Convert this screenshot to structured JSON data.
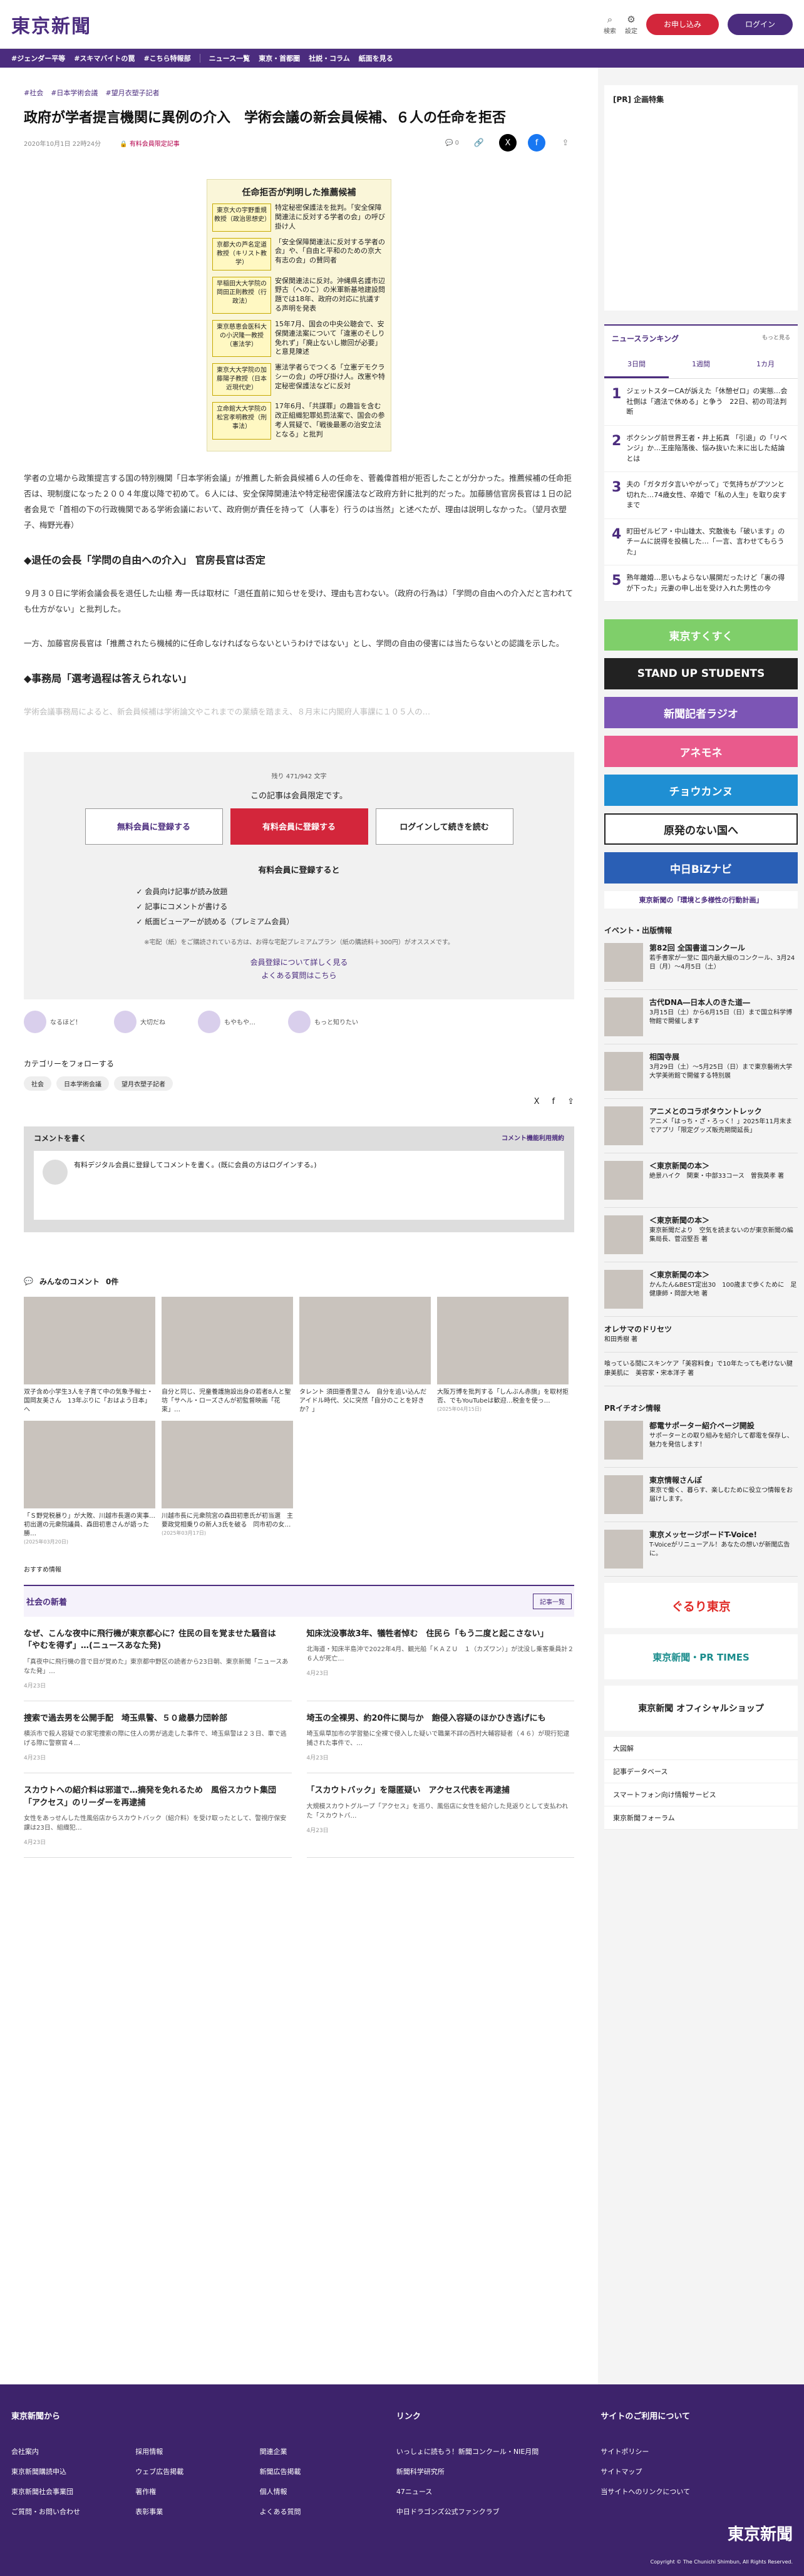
{
  "header": {
    "logo": "東京新聞",
    "search_label": "検索",
    "settings_label": "設定",
    "subscribe": "お申し込み",
    "login": "ログイン"
  },
  "nav": {
    "items": [
      "#ジェンダー平等",
      "#スキマバイトの罠",
      "#こちら特報部",
      "ニュース一覧",
      "東京・首都圏",
      "社説・コラム",
      "紙面を見る"
    ]
  },
  "article": {
    "tags": [
      "#社会",
      "#日本学術会議",
      "#望月衣塑子記者"
    ],
    "title": "政府が学者提言機関に異例の介入　学術会議の新会員候補、６人の任命を拒否",
    "date": "2020年10月1日 22時24分",
    "member_badge": "有料会員限定記事",
    "comment_count": "0",
    "figure_title": "任命拒否が判明した推薦候補",
    "figure_rows": [
      {
        "name": "東京大の宇野重規教授（政治思想史）",
        "desc": "特定秘密保護法を批判。「安全保障関連法に反対する学者の会」の呼び掛け人"
      },
      {
        "name": "京都大の芦名定道教授（キリスト教学）",
        "desc": "「安全保障関連法に反対する学者の会」や、「自由と平和のための京大有志の会」の賛同者"
      },
      {
        "name": "早稲田大大学院の岡田正則教授（行政法）",
        "desc": "安保関連法に反対。沖縄県名護市辺野古（へのこ）の米軍新基地建設問題では18年、政府の対応に抗議する声明を発表"
      },
      {
        "name": "東京慈恵会医科大の小沢隆一教授（憲法学）",
        "desc": "15年7月、国会の中央公聴会で、安保関連法案について「違憲のそしり免れず」「廃止ないし撤回が必要」と意見陳述"
      },
      {
        "name": "東京大大学院の加藤陽子教授（日本近現代史）",
        "desc": "憲法学者らでつくる「立憲デモクラシーの会」の呼び掛け人。改憲や特定秘密保護法などに反対"
      },
      {
        "name": "立命館大大学院の松宮孝明教授（刑事法）",
        "desc": "17年6月、「共謀罪」の趣旨を含む改正組織犯罪処罰法案で、国会の参考人質疑で、「戦後最悪の治安立法となる」と批判"
      }
    ],
    "p1": "学者の立場から政策提言する国の特別機関「日本学術会議」が推薦した新会員候補６人の任命を、菅義偉首相が拒否したことが分かった。推薦候補の任命拒否は、現制度になった２００４年度以降で初めて。６人には、安全保障関連法や特定秘密保護法など政府方針に批判的だった。加藤勝信官房長官は１日の記者会見で「首相の下の行政機関である学術会議において、政府側が責任を持って（人事を）行うのは当然」と述べたが、理由は説明しなかった。（望月衣塑子、梅野光春）",
    "h2a": "◆退任の会長「学問の自由への介入」 官房長官は否定",
    "p2": "９月３０日に学術会議会長を退任した山極 寿一氏は取材に「退任直前に知らせを受け、理由も言わない。（政府の行為は）「学問の自由への介入だと言われても仕方がない」と批判した。",
    "p3": "一方、加藤官房長官は「推薦されたら機械的に任命しなければならないというわけではない」とし、学問の自由の侵害には当たらないとの認識を示した。",
    "h2b": "◆事務局「選考過程は答えられない」",
    "p4": "学術会議事務局によると、新会員候補は学術論文やこれまでの業績を踏まえ、８月末に内閣府人事課に１０５人の…"
  },
  "paywall": {
    "count": "残り 471/942 文字",
    "lead": "この記事は会員限定です。",
    "free_btn": "無料会員に登録する",
    "paid_btn": "有料会員に登録する",
    "login_btn": "ログインして続きを読む",
    "sub": "有料会員に登録すると",
    "benefits": [
      "会員向け記事が読み放題",
      "記事にコメントが書ける",
      "紙面ビューアーが読める（プレミアム会員）"
    ],
    "note": "※宅配（紙）をご購読されている方は、お得な宅配プレミアムプラン（紙の購読料＋300円）がオススメです。",
    "link1": "会員登録について詳しく見る",
    "link2": "よくある質問はこちら"
  },
  "reactions": [
    "なるほど！",
    "大切だね",
    "もやもや…",
    "もっと知りたい"
  ],
  "follow": {
    "title": "カテゴリーをフォローする",
    "chips": [
      "社会",
      "日本学術会議",
      "望月衣塑子記者"
    ]
  },
  "comment": {
    "title": "コメントを書く",
    "policy": "コメント機能利用規約",
    "prompt": "有料デジタル会員に登録してコメントを書く。(既に会員の方はログインする。)"
  },
  "everyone": {
    "title": "みんなのコメント",
    "count": "0件"
  },
  "pics": [
    {
      "t": "双子含め小学生3人を子育て中の気象予報士・国岡友美さん　13年ぶりに「おはよう日本」へ",
      "d": ""
    },
    {
      "t": "自分と同じ、児童養護施設出身の若者8人と聖坊「サヘル・ローズさんが初監督映画「花束」…",
      "d": ""
    },
    {
      "t": "タレント 須田亜香里さん　自分を追い込んだアイドル時代、父に突然「自分のことを好きか？」",
      "d": ""
    },
    {
      "t": "大阪万博を批判する「しんぶん赤旗」を取材拒否、でもYouTubeは歓迎…税金を使っ…",
      "d": "(2025年04月15日)"
    },
    {
      "t": "「Ｓ野党税暴り」が大敗、川越市長選の実事…初出選の元衆院議員、森田初恵さんが語った勝…",
      "d": "(2025年03月20日)"
    },
    {
      "t": "川越市長に元衆院宮の森田初恵氏が初当選　主要政党相乗りの新人3氏を破る　同市初の女…",
      "d": "(2025年03月17日)"
    }
  ],
  "recommend": "おすすめ情報",
  "news": {
    "title": "社会の新着",
    "more": "記事一覧",
    "items": [
      {
        "ttl": "なぜ、こんな夜中に飛行機が東京都心に？住民の目を覚ませた騒音は「やむを得ず」…(ニュースあなた発)",
        "ex": "「真夜中に飛行機の音で目が覚めた」東京都中野区の読者から23日朝、東京新聞「ニュースあなた発」…",
        "dt": "4月23日"
      },
      {
        "ttl": "知床沈没事故3年、犠牲者悼む　住民ら「もう二度と起こさない」",
        "ex": "北海道・知床半島沖で2022年4月、観光船「ＫＡＺＵ　１（カズワン）」が沈没し乗客乗員計２６人が死亡…",
        "dt": "4月23日"
      },
      {
        "ttl": "捜索で過去男を公開手配　埼玉県警、５０歳暴力団幹部",
        "ex": "横浜市で殺人容疑での家宅捜索の際に住人の男が逃走した事件で、埼玉県警は２３日、車で逃げる際に警察官４…",
        "dt": "4月23日"
      },
      {
        "ttl": "埼玉の全裸男、約20件に関与か　飽侵入容疑のほかひき逃げにも",
        "ex": "埼玉県草加市の学習塾に全裸で侵入した疑いで職業不詳の西村大輔容疑者（４６）が現行犯逮捕された事件で、…",
        "dt": "4月23日"
      },
      {
        "ttl": "スカウトへの紹介料は邪道で…摘発を免れるため　風俗スカウト集団「アクセス」のリーダーを再逮捕",
        "ex": "女性をあっせんした性風俗店からスカウトバック（紹介料）を受け取ったとして、警視庁保安課は23日、組織犯…",
        "dt": "4月23日"
      },
      {
        "ttl": "「スカウトバック」を隠匿疑い　アクセス代表を再逮捕",
        "ex": "大規模スカウトグループ「アクセス」を巡り、風俗店に女性を紹介した見返りとして支払われた「スカウトバ…",
        "dt": "4月23日"
      }
    ]
  },
  "side": {
    "pr_title": "[PR] 企画特集",
    "rank_title": "ニュースランキング",
    "rank_more": "もっと見る",
    "rank_tabs": [
      "3日間",
      "1週間",
      "1カ月"
    ],
    "rank": [
      "ジェットスターCAが訴えた「休憩ゼロ」の実態…会社側は「適法で休める」と争う　22日、初の司法判断",
      "ボクシング前世界王者・井上拓真 「引退」の「リベンジ」か…王座陥落後、悩み抜いた末に出した結論とは",
      "夫の「ガタガタ言いやがって」で気持ちがプツンと切れた…74歳女性、卒婚で「私の人生」を取り戻すまで",
      "町田ゼルビア・中山雄太、究散後も「破います」のチームに説得を投稿した…「一言、言わせてもらうた」",
      "熟年離婚…思いもよらない展開だったけど「裏の得が下った」元妻の申し出を受け入れた男性の今"
    ],
    "banners": [
      "東京すくすく",
      "STAND UP STUDENTS",
      "新聞記者ラジオ",
      "アネモネ",
      "チョウカンヌ",
      "原発のない国へ",
      "中日BiZナビ",
      "東京新聞の「環境と多様性の行動計画」"
    ],
    "event_title": "イベント・出版情報",
    "events": [
      {
        "b": "第82回 全国書道コンクール",
        "x": "若手書家が一堂に 国内最大級のコンクール、3月24日（月）～4月5日（土）"
      },
      {
        "b": "古代DNA―日本人のきた道―",
        "x": "3月15日（土）から6月15日（日）まで国立科学博物館で開催します"
      },
      {
        "b": "相国寺展",
        "x": "3月29日（土）～5月25日（日）まで東京藝術大学大学美術館で開催する特別展"
      },
      {
        "b": "アニメとのコラボタウントレック",
        "x": "アニメ「はっち・ざ・ろっく！」2025年11月末までアプリ「限定グッズ販売期間延長」"
      },
      {
        "b": "＜東京新聞の本＞",
        "x": "絶景ハイク　関東・中部33コース　曽我英孝 著"
      },
      {
        "b": "＜東京新聞の本＞",
        "x": "東京新聞だより　空気を読まないのが東京新聞の編集局長、菅沼堅吾 著"
      },
      {
        "b": "＜東京新聞の本＞",
        "x": "かんたん&BEST定出30　100歳まで歩くために　足健康師・岡部大地 著"
      },
      {
        "b": "オレサマのドリセツ",
        "x": "和田秀樹 著"
      },
      {
        "b": "",
        "x": "喰っている間にスキンケア「美容料食」で10年たっても老けない腱康美肌に　美容家・宋本洋子 著"
      }
    ],
    "pr2_title": "PRイチオシ情報",
    "pr2": [
      {
        "b": "都電サポーター紹介ページ開設",
        "x": "サポーターとの取り組みを紹介して都電を保存し、魅力を発信します！"
      },
      {
        "b": "東京情報さんぽ",
        "x": "東京で働く、暮らす、楽しむために役立つ情報をお届けします。"
      },
      {
        "b": "東京メッセージボードT-Voice!",
        "x": "T-Voiceがリニューアル！あなたの想いが新聞広告に。"
      }
    ],
    "big_banners": [
      "ぐるり東京",
      "東京新聞・PR TIMES",
      "東京新聞 オフィシャルショップ"
    ],
    "links": [
      "大図解",
      "記事データベース",
      "スマートフォン向け情報サービス",
      "東京新聞フォーラム"
    ]
  },
  "footer": {
    "col1": "東京新聞から",
    "col1_items": [
      "会社案内",
      "採用情報",
      "関連企業",
      "東京新聞購読申込",
      "ウェブ広告掲載",
      "新聞広告掲載",
      "東京新聞社会事業団",
      "著作権",
      "個人情報",
      "ご質問・お問い合わせ",
      "表彰事業",
      "よくある質問"
    ],
    "col2": "リンク",
    "col2_items": [
      "いっしょに読もう！新聞コンクール・NIE月間",
      "新聞科学研究所",
      "47ニュース",
      "中日ドラゴンズ公式ファンクラブ"
    ],
    "col3": "サイトのご利用について",
    "col3_items": [
      "サイトポリシー",
      "サイトマップ",
      "当サイトへのリンクについて"
    ],
    "logo": "東京新聞",
    "copy": "Copyright © The Chunichi Shimbun, All Rights Reserved."
  }
}
